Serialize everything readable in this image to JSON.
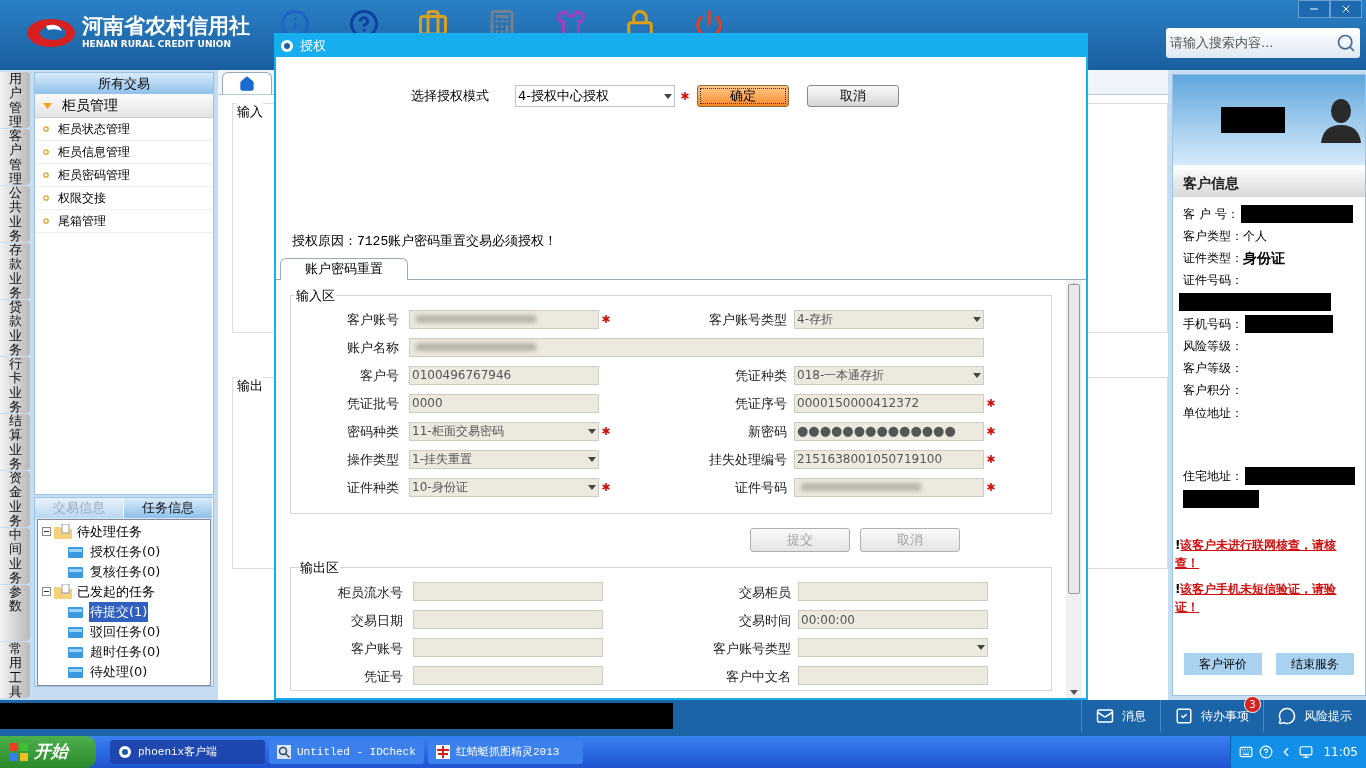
{
  "header": {
    "logo_cn": "河南省农村信用社",
    "logo_en": "HENAN RURAL CREDIT UNION"
  },
  "search": {
    "placeholder": "请输入搜索内容..."
  },
  "nav_tabs": [
    "用户管理",
    "客户管理",
    "公共业务",
    "存款业务",
    "贷款业务",
    "行卡业务",
    "结算业务",
    "资金业务",
    "中间业务",
    "参数",
    "常用工具"
  ],
  "sidebar": {
    "title": "所有交易",
    "group": {
      "label": "柜员管理",
      "expanded": true
    },
    "items": [
      "柜员状态管理",
      "柜员信息管理",
      "柜员密码管理",
      "权限交接",
      "尾箱管理"
    ]
  },
  "task_panel": {
    "tabs": [
      {
        "label": "交易信息",
        "selected": false
      },
      {
        "label": "任务信息",
        "selected": true
      }
    ],
    "tree": [
      {
        "label": "待处理任务",
        "expanded": true,
        "children": [
          {
            "label": "授权任务(0)",
            "selected": false
          },
          {
            "label": "复核任务(0)",
            "selected": false
          }
        ]
      },
      {
        "label": "已发起的任务",
        "expanded": true,
        "children": [
          {
            "label": "待提交(1)",
            "selected": true
          },
          {
            "label": "驳回任务(0)",
            "selected": false
          },
          {
            "label": "超时任务(0)",
            "selected": false
          },
          {
            "label": "待处理(0)",
            "selected": false
          }
        ]
      }
    ]
  },
  "background_form": {
    "sections": [
      "输入",
      "输出"
    ]
  },
  "dialog": {
    "title": "授权",
    "mode_label": "选择授权模式",
    "mode_value": "4-授权中心授权",
    "mode_required": true,
    "buttons": [
      {
        "label": "确定",
        "kind": "primary"
      },
      {
        "label": "取消",
        "kind": "normal"
      }
    ],
    "reason": "授权原因：7125账户密码重置交易必须授权！",
    "tab": "账户密码重置",
    "input_title": "输入区",
    "input_fields": [
      {
        "label": "客户账号",
        "kind": "blurred",
        "required": true,
        "wide": false
      },
      {
        "label": "客户账号类型",
        "kind": "select",
        "value": "4-存折",
        "wide": false
      },
      {
        "label": "账户名称",
        "kind": "blurred",
        "wide": true
      },
      {
        "label": "客户号",
        "kind": "text",
        "value": "0100496767946",
        "wide": false
      },
      {
        "label": "凭证种类",
        "kind": "select",
        "value": "018-一本通存折",
        "wide": false
      },
      {
        "label": "凭证批号",
        "kind": "text",
        "value": "0000",
        "wide": false
      },
      {
        "label": "凭证序号",
        "kind": "text",
        "value": "0000150000412372",
        "required": true,
        "wide": false
      },
      {
        "label": "密码种类",
        "kind": "select",
        "value": "11-柜面交易密码",
        "required": true,
        "wide": false
      },
      {
        "label": "新密码",
        "kind": "password",
        "value": "●●●●●●●●●●●●●●",
        "required": true,
        "wide": false
      },
      {
        "label": "操作类型",
        "kind": "select",
        "value": "1-挂失重置",
        "wide": false
      },
      {
        "label": "挂失处理编号",
        "kind": "text",
        "value": "2151638001050719100",
        "required": true,
        "wide": false
      },
      {
        "label": "证件种类",
        "kind": "select",
        "value": "10-身份证",
        "required": true,
        "wide": false
      },
      {
        "label": "证件号码",
        "kind": "blurred",
        "required": true,
        "wide": false
      }
    ],
    "actions": [
      {
        "label": "提交",
        "disabled": true
      },
      {
        "label": "取消",
        "disabled": true
      }
    ],
    "output_title": "输出区",
    "output_fields": [
      {
        "label": "柜员流水号",
        "kind": "text"
      },
      {
        "label": "交易柜员",
        "kind": "text"
      },
      {
        "label": "交易日期",
        "kind": "text"
      },
      {
        "label": "交易时间",
        "kind": "text",
        "value": "00:00:00"
      },
      {
        "label": "客户账号",
        "kind": "text"
      },
      {
        "label": "客户账号类型",
        "kind": "select"
      },
      {
        "label": "凭证号",
        "kind": "text"
      },
      {
        "label": "客户中文名",
        "kind": "text"
      }
    ]
  },
  "customer_panel": {
    "title": "客户信息",
    "rows": [
      {
        "label": "客 户 号：",
        "kind": "redacted"
      },
      {
        "label": "客户类型：",
        "kind": "text",
        "value": "个人"
      },
      {
        "label": "证件类型：",
        "kind": "bold",
        "value": "身份证"
      },
      {
        "label": "证件号码：",
        "kind": "redacted-below"
      },
      {
        "label": "手机号码：",
        "kind": "redacted"
      },
      {
        "label": "风险等级：",
        "kind": "empty"
      },
      {
        "label": "客户等级：",
        "kind": "empty"
      },
      {
        "label": "客户积分：",
        "kind": "empty"
      },
      {
        "label": "单位地址：",
        "kind": "empty-tall"
      },
      {
        "label": "住宅地址：",
        "kind": "redacted-two"
      }
    ],
    "warnings": [
      {
        "mark": "!",
        "text": "该客户未进行联网核查，请核查！"
      },
      {
        "mark": "!",
        "text": "该客户手机未短信验证，请验证！"
      }
    ],
    "buttons": [
      "客户评价",
      "结束服务"
    ]
  },
  "status_bar": {
    "items": [
      {
        "kind": "message",
        "label": "消息"
      },
      {
        "kind": "todo",
        "label": "待办事项",
        "badge": "3"
      },
      {
        "kind": "risk",
        "label": "风险提示"
      }
    ]
  },
  "taskbar": {
    "start": "开始",
    "tasks": [
      {
        "label": "phoenix客户端",
        "kind": "app"
      },
      {
        "label": "Untitled - IDCheck",
        "kind": "search"
      },
      {
        "label": "红蜻蜓抓图精灵2013",
        "kind": "capture"
      }
    ],
    "clock": "11:05"
  }
}
